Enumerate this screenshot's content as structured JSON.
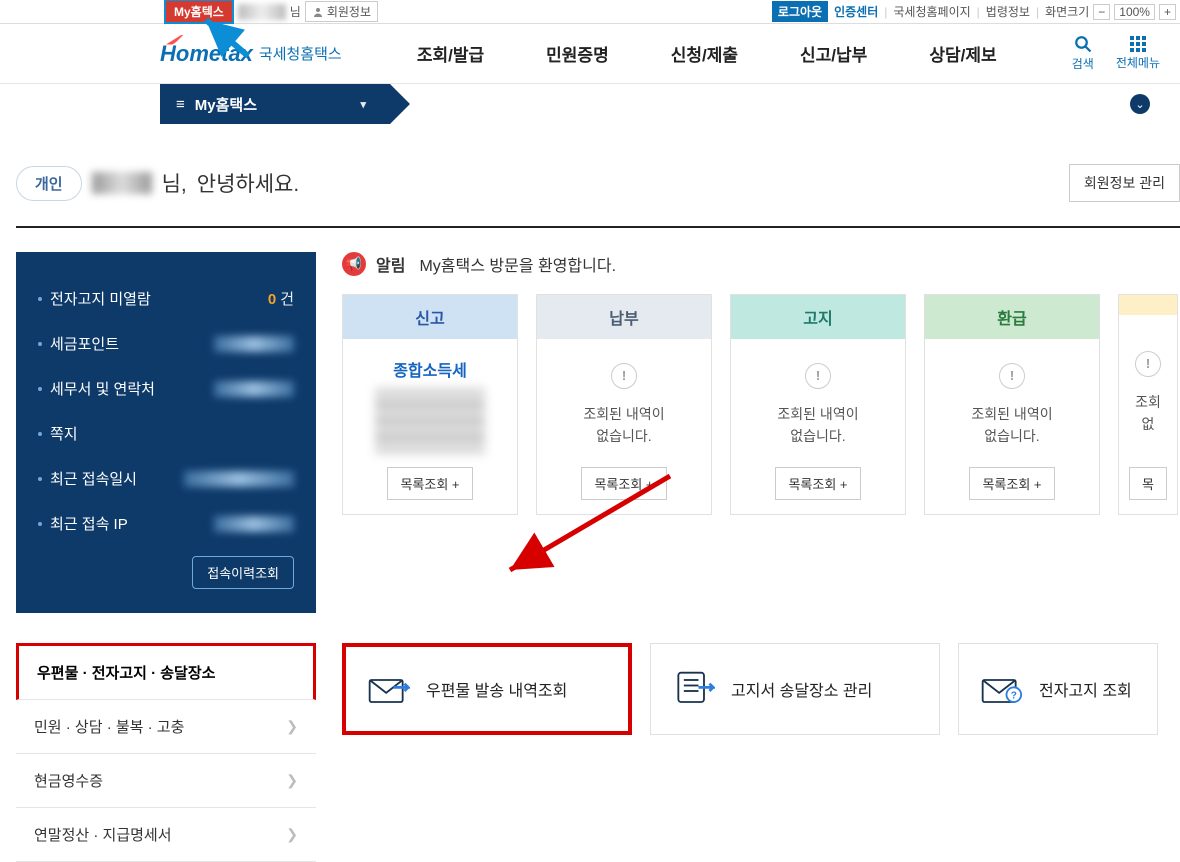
{
  "topbar": {
    "myhometax": "My홈텍스",
    "nim_suffix": "님",
    "memberinfo": "회원정보",
    "logout": "로그아웃",
    "certcenter": "인증센터",
    "nts_home": "국세청홈페이지",
    "law_info": "법령정보",
    "screen_size": "화면크기",
    "zoom": "100%"
  },
  "logo": {
    "mark": "Hometax",
    "sub": "국세청홈택스"
  },
  "nav": {
    "n1": "조회/발급",
    "n2": "민원증명",
    "n3": "신청/제출",
    "n4": "신고/납부",
    "n5": "상담/제보"
  },
  "header_right": {
    "search": "검색",
    "allmenu": "전체메뉴"
  },
  "ribbon": {
    "hamburger": "≡",
    "title": "My홈택스",
    "chev": "▾",
    "circle": "⌄"
  },
  "greet": {
    "badge": "개인",
    "nim": "님,",
    "hello": "안녕하세요.",
    "member_manage": "회원정보 관리"
  },
  "navy": {
    "items": [
      {
        "label": "전자고지 미열람",
        "count": "0",
        "unit": "건"
      },
      {
        "label": "세금포인트"
      },
      {
        "label": "세무서 및 연락처"
      },
      {
        "label": "쪽지"
      },
      {
        "label": "최근 접속일시"
      },
      {
        "label": "최근 접속 IP"
      }
    ],
    "history_btn": "접속이력조회"
  },
  "alert": {
    "label": "알림",
    "text": "My홈택스 방문을 환영합니다."
  },
  "cards": {
    "c1": {
      "head": "신고",
      "subtitle": "종합소득세",
      "btn": "목록조회 +"
    },
    "c2": {
      "head": "납부",
      "msg1": "조회된 내역이",
      "msg2": "없습니다.",
      "btn": "목록조회 +"
    },
    "c3": {
      "head": "고지",
      "msg1": "조회된 내역이",
      "msg2": "없습니다.",
      "btn": "목록조회 +"
    },
    "c4": {
      "head": "환급",
      "msg1": "조회된 내역이",
      "msg2": "없습니다.",
      "btn": "목록조회 +"
    },
    "c5": {
      "head": "",
      "msg1": "조회",
      "msg2": "없",
      "btn": "목"
    }
  },
  "tabs": {
    "t1": "우편물 · 전자고지 · 송달장소",
    "t2": "민원 · 상담 · 불복 · 고충",
    "t3": "현금영수증",
    "t4": "연말정산 · 지급명세서"
  },
  "actions": {
    "a1": "우편물 발송 내역조회",
    "a2": "고지서 송달장소 관리",
    "a3": "전자고지 조회"
  }
}
